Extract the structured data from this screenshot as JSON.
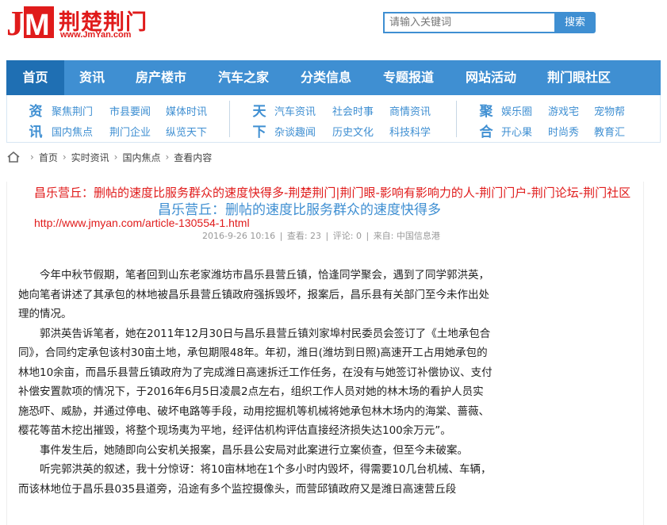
{
  "header": {
    "logo_mark": "JM",
    "logo_name": "荆楚荆门",
    "logo_url": "www.JmYan.com",
    "search_placeholder": "请输入关键词",
    "search_button": "搜索"
  },
  "nav": {
    "items": [
      "首页",
      "资讯",
      "房产楼市",
      "汽车之家",
      "分类信息",
      "专题报道",
      "网站活动",
      "荆门眼社区"
    ],
    "active_index": 0
  },
  "subnav": {
    "group1": {
      "head_top": "资",
      "head_bottom": "讯",
      "row1": [
        "聚焦荆门",
        "市县要闻",
        "媒体时讯"
      ],
      "row2": [
        "国内焦点",
        "荆门企业",
        "纵览天下"
      ]
    },
    "group2": {
      "head_top": "天",
      "head_bottom": "下",
      "row1": [
        "汽车资讯",
        "社会时事",
        "商情资讯"
      ],
      "row2": [
        "杂谈趣闻",
        "历史文化",
        "科技科学"
      ]
    },
    "group3": {
      "head_top": "聚",
      "head_bottom": "合",
      "row1": [
        "娱乐圈",
        "游戏宅",
        "宠物帮"
      ],
      "row2": [
        "开心果",
        "时尚秀",
        "教育汇"
      ]
    }
  },
  "breadcrumb": {
    "items": [
      "首页",
      "实时资讯",
      "国内焦点",
      "查看内容"
    ]
  },
  "article": {
    "overlay_title": "昌乐营丘：删帖的速度比服务群众的速度快得多-荆楚荆门|荆门眼-影响有影响力的人-荆门门户-荆门论坛-荆门社区",
    "overlay_url": "http://www.jmyan.com/article-130554-1.html",
    "title": "昌乐营丘：删帖的速度比服务群众的速度快得多",
    "date": "2016-9-26 10:16",
    "views_label": "查看: 23",
    "comments_label": "评论: 0",
    "source_label": "来自: 中国信息港",
    "paragraphs": [
      "今年中秋节假期，笔者回到山东老家潍坊市昌乐县营丘镇，恰逢同学聚会，遇到了同学郭洪英，她向笔者讲述了其承包的林地被昌乐县营丘镇政府强拆毁坏，报案后，昌乐县有关部门至今未作出处理的情况。",
      "郭洪英告诉笔者，她在2011年12月30日与昌乐县营丘镇刘家埠村民委员会签订了《土地承包合同》，合同约定承包该村30亩土地，承包期限48年。年初，潍日(潍坊到日照)高速开工占用她承包的林地10余亩，而昌乐县营丘镇政府为了完成潍日高速拆迁工作任务，在没有与她签订补偿协议、支付补偿安置款项的情况下，于2016年6月5日凌晨2点左右，组织工作人员对她的林木场的看护人员实施恐吓、威胁，并通过停电、破坏电路等手段，动用挖掘机等机械将她承包林木场内的海棠、蔷薇、樱花等苗木挖出摧毁，将整个现场夷为平地，经评估机构评估直接经济损失达100余万元”。",
      "事件发生后，她随即向公安机关报案，昌乐县公安局对此案进行立案侦查，但至今未破案。",
      "听完郭洪英的叙述，我十分惊讶：将10亩林地在1个多小时内毁坏，得需要10几台机械、车辆，而该林地位于昌乐县035县道旁，沿途有多个监控摄像头，而营邱镇政府又是潍日高速营丘段"
    ]
  },
  "colors": {
    "brand_red": "#e01b1b",
    "brand_blue": "#3f8fd2",
    "nav_active": "#1f6fb3"
  }
}
